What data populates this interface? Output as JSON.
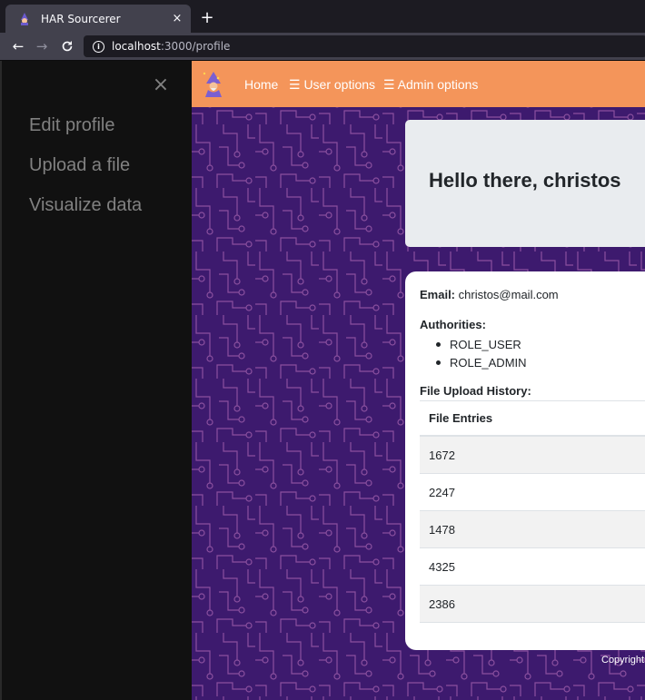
{
  "browser": {
    "tab_title": "HAR Sourcerer",
    "tab_close": "×",
    "new_tab": "+",
    "url_host": "localhost",
    "url_path": ":3000/profile"
  },
  "sidebar": {
    "close": "×",
    "items": [
      {
        "label": "Edit profile"
      },
      {
        "label": "Upload a file"
      },
      {
        "label": "Visualize data"
      }
    ]
  },
  "appbar": {
    "menu": [
      {
        "label": "Home"
      },
      {
        "label": "☰ User options"
      },
      {
        "label": "☰ Admin options"
      }
    ]
  },
  "profile": {
    "greeting": "Hello there, christos",
    "email_label": "Email:",
    "email": "christos@mail.com",
    "authorities_label": "Authorities:",
    "authorities": [
      "ROLE_USER",
      "ROLE_ADMIN"
    ],
    "history_label": "File Upload History:",
    "table_header": "File Entries",
    "entries": [
      "1672",
      "2247",
      "1478",
      "4325",
      "2386"
    ]
  },
  "footer": {
    "text": "Copyright"
  },
  "colors": {
    "appbar": "#f4955a",
    "background": "#3d1a6e",
    "circuit": "#8a4f9e",
    "sidebar": "#111111"
  }
}
